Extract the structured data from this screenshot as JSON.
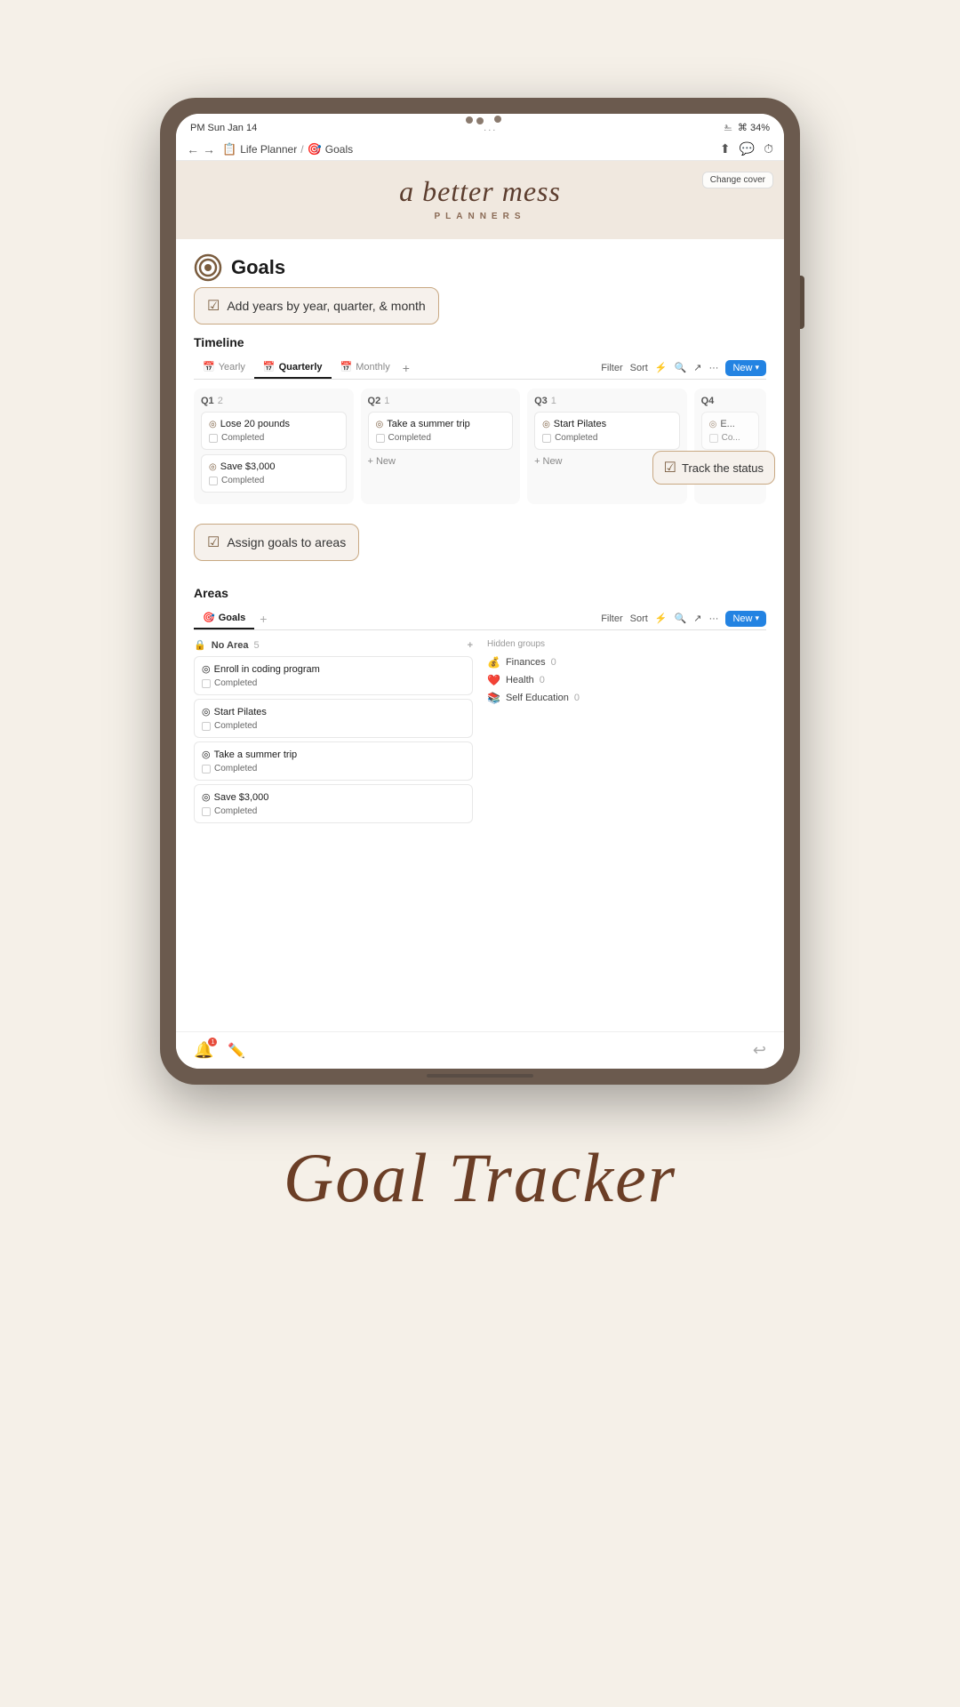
{
  "page": {
    "background_color": "#f5f0e8"
  },
  "status_bar": {
    "time": "PM  Sun Jan 14",
    "dots": "...",
    "wifi": "⌘ 34%"
  },
  "browser": {
    "back": "←",
    "forward": "→",
    "breadcrumb": {
      "planner_icon": "📋",
      "planner_label": "Life Planner",
      "separator": "/",
      "goals_icon": "🎯",
      "goals_label": "Goals"
    },
    "actions": [
      "⬆",
      "💬",
      "⏱"
    ]
  },
  "cover": {
    "change_cover_label": "Change cover",
    "title": "a better mess",
    "subtitle": "PLANNERS"
  },
  "goals": {
    "icon": "🎯",
    "title": "Goals"
  },
  "annotation_add_years": {
    "check": "☑",
    "text": "Add years by year, quarter, & month"
  },
  "timeline": {
    "section_title": "Timeline",
    "tabs": [
      {
        "label": "Yearly",
        "icon": "📅",
        "active": false
      },
      {
        "label": "Quarterly",
        "icon": "📅",
        "active": true
      },
      {
        "label": "Monthly",
        "icon": "📅",
        "active": false
      }
    ],
    "actions": {
      "filter": "Filter",
      "sort": "Sort",
      "lightning": "⚡",
      "search": "🔍",
      "export": "↗",
      "more": "...",
      "new_label": "New",
      "new_arrow": "▾"
    },
    "columns": [
      {
        "id": "q1",
        "label": "Q1",
        "count": "2",
        "cards": [
          {
            "name": "Lose 20 pounds",
            "status": "Completed"
          },
          {
            "name": "Save $3,000",
            "status": "Completed"
          }
        ],
        "add_label": "+ New"
      },
      {
        "id": "q2",
        "label": "Q2",
        "count": "1",
        "cards": [
          {
            "name": "Take a summer trip",
            "status": "Completed"
          }
        ],
        "add_label": "+ New"
      },
      {
        "id": "q3",
        "label": "Q3",
        "count": "1",
        "cards": [
          {
            "name": "Start Pilates",
            "status": "Completed"
          }
        ],
        "add_label": "+ New"
      },
      {
        "id": "q4",
        "label": "Q4",
        "count": "",
        "cards": [
          {
            "name": "E...",
            "status": "Co..."
          }
        ],
        "add_label": ""
      }
    ]
  },
  "annotation_track_status": {
    "check": "☑",
    "text": "Track the status"
  },
  "annotation_assign_goals": {
    "check": "☑",
    "text": "Assign goals to areas"
  },
  "areas": {
    "section_title": "Areas",
    "tabs": [
      {
        "label": "Goals",
        "icon": "🎯",
        "active": true
      },
      {
        "add": "+"
      }
    ],
    "actions": {
      "filter": "Filter",
      "sort": "Sort",
      "lightning": "⚡",
      "search": "🔍",
      "export": "↗",
      "more": "...",
      "new_label": "New",
      "new_arrow": "▾"
    },
    "no_area": {
      "label": "No Area",
      "count": "5",
      "add": "+",
      "items": [
        {
          "name": "Enroll in coding program",
          "status": "Completed"
        },
        {
          "name": "Start Pilates",
          "status": "Completed"
        },
        {
          "name": "Take a summer trip",
          "status": "Completed"
        },
        {
          "name": "Save $3,000",
          "status": "Completed"
        }
      ]
    },
    "hidden_groups": {
      "label": "Hidden groups",
      "items": [
        {
          "icon": "💰",
          "name": "Finances",
          "count": "0"
        },
        {
          "icon": "❤️",
          "name": "Health",
          "count": "0"
        },
        {
          "icon": "📚",
          "name": "Self Education",
          "count": "0"
        }
      ]
    }
  },
  "bottom_bar": {
    "bell_badge": "1",
    "edit": "✏️",
    "back": "↩"
  },
  "footer_title": "Goal Tracker"
}
